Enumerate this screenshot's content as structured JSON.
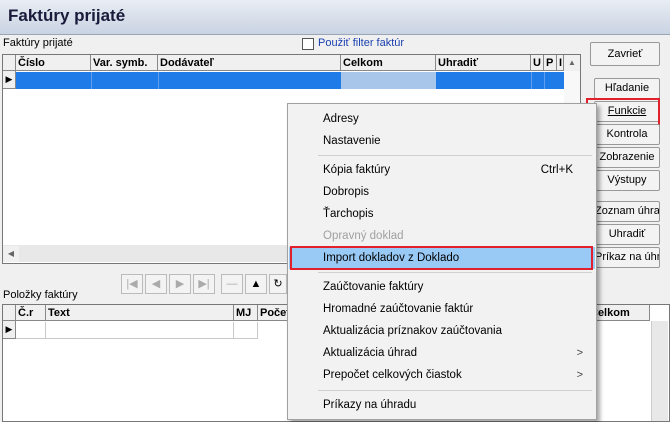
{
  "window": {
    "title": "Faktúry prijaté"
  },
  "invoices": {
    "section_label": "Faktúry prijaté",
    "filter_checkbox_label": "Použiť filter faktúr",
    "columns": [
      "Číslo",
      "Var. symb.",
      "Dodávateľ",
      "Celkom",
      "Uhradiť",
      "U",
      "P",
      "I"
    ]
  },
  "side_buttons": {
    "close": "Zavrieť",
    "search": "Hľadanie",
    "functions": "Funkcie",
    "control": "Kontrola",
    "display": "Zobrazenie",
    "outputs": "Výstupy",
    "payments_list": "Zoznam úhrad",
    "pay": "Uhradiť",
    "payment_order": "Príkaz na úhr."
  },
  "items": {
    "section_label": "Položky faktúry",
    "columns": [
      "Č.r",
      "Text",
      "MJ",
      "Počet",
      "Celkom"
    ]
  },
  "context_menu": {
    "items": [
      {
        "label": "Adresy"
      },
      {
        "label": "Nastavenie"
      },
      {
        "label": "Kópia faktúry",
        "shortcut": "Ctrl+K"
      },
      {
        "label": "Dobropis"
      },
      {
        "label": "Ťarchopis"
      },
      {
        "label": "Opravný doklad",
        "disabled": true
      },
      {
        "label": "Import dokladov z Doklado",
        "selected": true
      },
      {
        "label": "Zaúčtovanie faktúry"
      },
      {
        "label": "Hromadné zaúčtovanie faktúr"
      },
      {
        "label": "Aktualizácia príznakov zaúčtovania"
      },
      {
        "label": "Aktualizácia úhrad",
        "submenu": true
      },
      {
        "label": "Prepočet celkových čiastok",
        "submenu": true
      },
      {
        "label": "Príkazy na úhradu"
      }
    ]
  },
  "colors": {
    "selection": "#1e7be8",
    "highlight": "#e0202a",
    "menu_selected": "#99c9f5"
  }
}
